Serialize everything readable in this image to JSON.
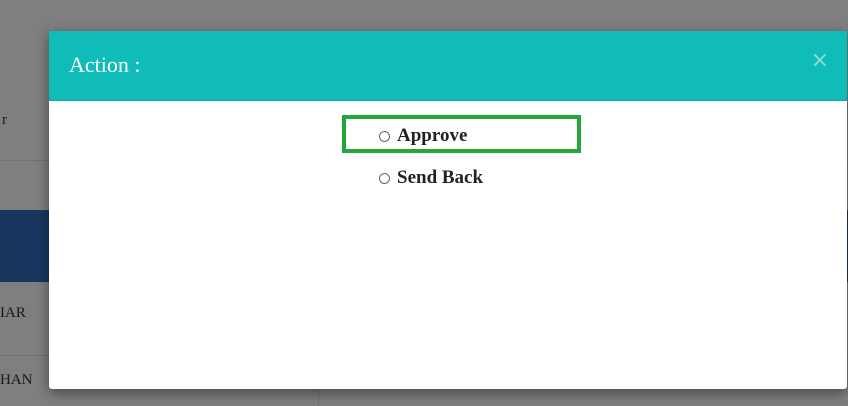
{
  "background": {
    "row_label_1": "r",
    "row_label_2": "IAR",
    "row_label_3": "HAN"
  },
  "modal": {
    "title": "Action :",
    "close_label": "×",
    "options": [
      {
        "label": "Approve",
        "selected": false,
        "highlighted": true
      },
      {
        "label": "Send Back",
        "selected": false,
        "highlighted": false
      }
    ]
  },
  "colors": {
    "header": "#0fbcb8",
    "highlight": "#22a83a",
    "band": "#2f6fbf"
  }
}
